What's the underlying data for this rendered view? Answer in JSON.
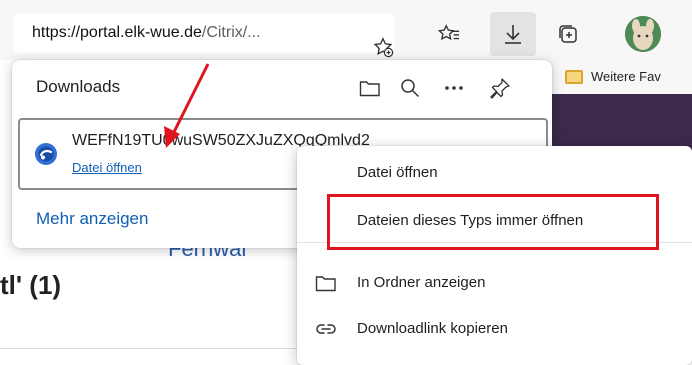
{
  "toolbar": {
    "url_host": "https://portal.elk-wue.de",
    "url_path": "/Citrix/..."
  },
  "favorites_bar": {
    "item_label": "Weitere Fav"
  },
  "background": {
    "partial_link": "Fernwar",
    "partial_heading": "tl' (1)"
  },
  "downloads": {
    "title": "Downloads",
    "item": {
      "file_name": "WEFfN19TU0wuSW50ZXJuZXQgQmlvd2",
      "action_label": "Datei öffnen"
    },
    "more_label": "Mehr anzeigen"
  },
  "context_menu": {
    "items": [
      {
        "label": "Datei öffnen"
      },
      {
        "label": "Dateien dieses Typs immer öffnen"
      },
      {
        "label": "In Ordner anzeigen"
      },
      {
        "label": "Downloadlink kopieren"
      }
    ]
  },
  "colors": {
    "accent": "#0f5fb4",
    "annotation": "#e0141e"
  }
}
